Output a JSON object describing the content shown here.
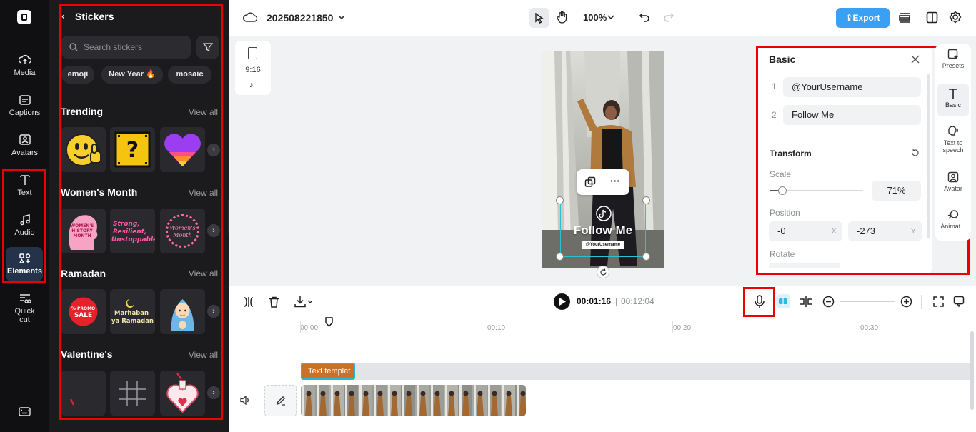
{
  "rail": {
    "items": [
      {
        "label": "Media"
      },
      {
        "label": "Captions"
      },
      {
        "label": "Avatars"
      },
      {
        "label": "Text"
      },
      {
        "label": "Audio"
      },
      {
        "label": "Elements"
      },
      {
        "label1": "Quick",
        "label2": "cut"
      }
    ]
  },
  "panel": {
    "title": "Stickers",
    "search_placeholder": "Search stickers",
    "chips": [
      "emoji",
      "New Year 🔥",
      "mosaic"
    ],
    "sections": [
      {
        "title": "Trending",
        "view_all": "View all"
      },
      {
        "title": "Women's Month",
        "view_all": "View all"
      },
      {
        "title": "Ramadan",
        "view_all": "View all"
      },
      {
        "title": "Valentine's",
        "view_all": "View all"
      }
    ],
    "sticker_texts": {
      "womens1": "WOMEN'S HISTORY MONTH",
      "womens2a": "Strong,",
      "womens2b": "Resilient,",
      "womens2c": "Unstoppable",
      "womens3": "Women's Month",
      "promo1": "% PROMO",
      "promo2": "SALE",
      "marhaban1": "Marhaban",
      "marhaban2": "ya Ramadan"
    }
  },
  "topbar": {
    "project_name": "202508221850",
    "zoom": "100%",
    "export_label": "Export"
  },
  "canvas": {
    "ratio": "9:16",
    "overlay_title": "Follow Me",
    "overlay_username": "@YourUsername"
  },
  "props": {
    "title": "Basic",
    "text_rows": [
      {
        "index": "1",
        "value": "@YourUsername"
      },
      {
        "index": "2",
        "value": "Follow Me"
      }
    ],
    "transform_label": "Transform",
    "scale_label": "Scale",
    "scale_value": "71%",
    "scale_fraction": 0.14,
    "position_label": "Position",
    "pos_x": "-0",
    "pos_x_axis": "X",
    "pos_y": "-273",
    "pos_y_axis": "Y",
    "rotate_label": "Rotate"
  },
  "tools": [
    {
      "label": "Presets"
    },
    {
      "label": "Basic"
    },
    {
      "label1": "Text to",
      "label2": "speech"
    },
    {
      "label": "Avatar"
    },
    {
      "label": "Animat..."
    }
  ],
  "timeline": {
    "current_time": "00:01:16",
    "total_time": "00:12:04",
    "ticks": [
      "00:00",
      "00:10",
      "00:20",
      "00:30"
    ],
    "text_clip_label": "Text templat"
  },
  "colors": {
    "accent": "#3aa0f3",
    "highlight_red": "#e00000",
    "text_clip": "#c9712a"
  }
}
